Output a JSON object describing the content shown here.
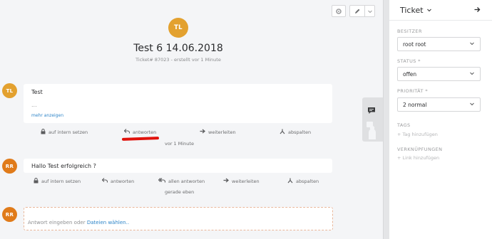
{
  "header": {
    "avatar_initials": "TL",
    "title": "Test 6 14.06.2018",
    "meta": "Ticket# 87023 - erstellt vor 1 Minute"
  },
  "articles": [
    {
      "avatar_initials": "TL",
      "text": "Test",
      "ellipsis": "...",
      "more_link": "mehr anzeigen",
      "actions": {
        "internal": "auf intern setzen",
        "reply": "antworten",
        "forward": "weiterleiten",
        "split": "abspalten"
      },
      "timestamp": "vor 1 Minute"
    },
    {
      "avatar_initials": "RR",
      "text": "Hallo Test erfolgreich ?",
      "actions": {
        "internal": "auf intern setzen",
        "reply": "antworten",
        "reply_all": "allen antworten",
        "forward": "weiterleiten",
        "split": "abspalten"
      },
      "timestamp": "gerade eben"
    }
  ],
  "reply": {
    "avatar_initials": "RR",
    "placeholder_text": "Antwort eingeben oder ",
    "placeholder_link": "Dateien wählen.."
  },
  "sidebar": {
    "title": "Ticket",
    "owner_label": "BESITZER",
    "owner_value": "root root",
    "state_label": "STATUS *",
    "state_value": "offen",
    "priority_label": "PRIORITÄT *",
    "priority_value": "2 normal",
    "tags_label": "TAGS",
    "tags_add": "+ Tag hinzufügen",
    "links_label": "VERKNÜPFUNGEN",
    "links_add": "+ Link hinzufügen"
  },
  "colors": {
    "avatar_tl": "#e3a12f",
    "avatar_rr": "#e07b1a",
    "link": "#2e85c8",
    "annotation_red": "#e0120c"
  },
  "icons": [
    "gear-icon",
    "pencil-icon",
    "chevron-down-icon",
    "arrow-right-icon",
    "lock-icon",
    "reply-icon",
    "reply-all-icon",
    "forward-icon",
    "split-icon",
    "chat-icon",
    "customer-icon"
  ]
}
